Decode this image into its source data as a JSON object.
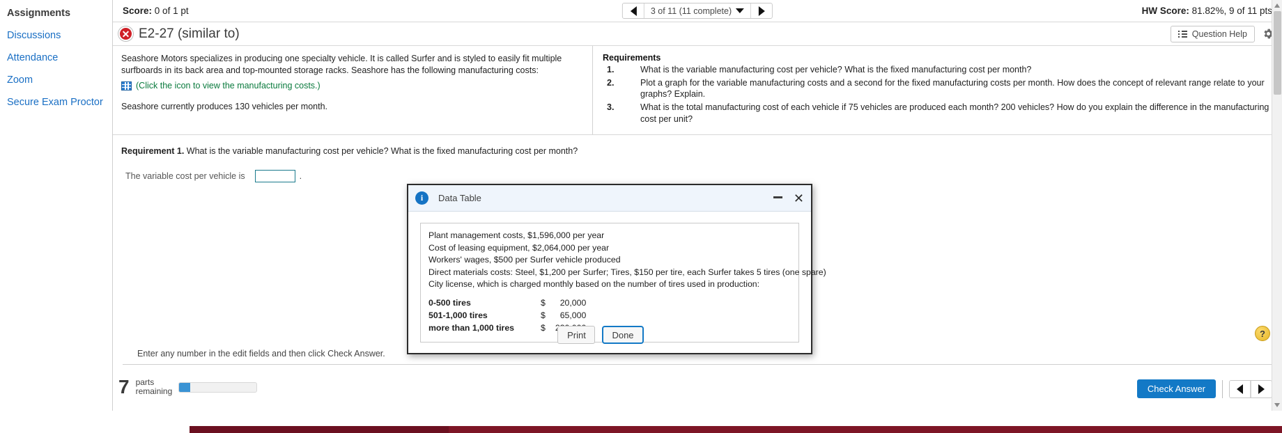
{
  "sidebar": {
    "items": [
      {
        "label": "Assignments",
        "active": true
      },
      {
        "label": "Discussions",
        "active": false
      },
      {
        "label": "Attendance",
        "active": false
      },
      {
        "label": "Zoom",
        "active": false
      },
      {
        "label": "Secure Exam Proctor",
        "active": false
      }
    ]
  },
  "topbar": {
    "score_label": "Score:",
    "score_value": "0 of 1 pt",
    "nav_selection": "3 of 11 (11 complete)",
    "prev_icon": "triangle-left-icon",
    "next_icon": "triangle-right-icon",
    "dropdown_icon": "caret-down-icon",
    "hw_score_label": "HW Score:",
    "hw_score_value": "81.82%, 9 of 11 pts"
  },
  "question_header": {
    "status_icon": "incorrect-x-icon",
    "status_glyph": "✕",
    "title": "E2-27 (similar to)",
    "help_button": "Question Help",
    "help_icon": "list-icon",
    "settings_icon": "gear-icon"
  },
  "problem": {
    "paragraph": "Seashore Motors specializes in producing one specialty vehicle. It is called Surfer and is styled to easily fit multiple surfboards in its back area and top-mounted storage racks. Seashore has the following manufacturing costs:",
    "data_link_icon": "table-grid-icon",
    "data_link": "(Click the icon to view the manufacturing costs.)",
    "production_line": "Seashore currently produces 130 vehicles per month."
  },
  "requirements": {
    "heading": "Requirements",
    "items": [
      {
        "num": "1.",
        "text": "What is the variable manufacturing cost per vehicle? What is the fixed manufacturing cost per month?"
      },
      {
        "num": "2.",
        "text": "Plot a graph for the variable manufacturing costs and a second for the fixed manufacturing costs per month. How does the concept of relevant range relate to your graphs? Explain."
      },
      {
        "num": "3.",
        "text": "What is the total manufacturing cost of each vehicle if 75 vehicles are produced each month? 200 vehicles? How do you explain the difference in the manufacturing cost per unit?"
      }
    ]
  },
  "requirement1": {
    "label": "Requirement 1.",
    "question": "What is the variable manufacturing cost per vehicle? What is the fixed manufacturing cost per month?",
    "answer_label": "The variable cost per vehicle is",
    "answer_value": "",
    "answer_placeholder": "",
    "period": "."
  },
  "footer": {
    "instruction": "Enter any number in the edit fields and then click Check Answer.",
    "parts_count": "7",
    "parts_label_line1": "parts",
    "parts_label_line2": "remaining",
    "progress_percent": 14,
    "check_answer": "Check Answer",
    "prev_icon": "triangle-left-icon",
    "next_icon": "triangle-right-icon",
    "help_icon": "question-mark-icon",
    "help_glyph": "?"
  },
  "modal": {
    "icon": "info-icon",
    "icon_glyph": "i",
    "title": "Data Table",
    "minimize_icon": "minimize-icon",
    "close_icon": "close-icon",
    "close_glyph": "✕",
    "lines": [
      "Plant management costs, $1,596,000 per year",
      "Cost of leasing equipment, $2,064,000 per year",
      "Workers' wages, $500 per Surfer vehicle produced",
      "Direct materials costs: Steel, $1,200 per Surfer; Tires, $150 per tire, each Surfer takes 5 tires (one spare)",
      "City license, which is charged monthly based on the number of tires used in production:"
    ],
    "rows": [
      {
        "label": "0-500 tires",
        "currency": "$",
        "value": "20,000"
      },
      {
        "label": "501-1,000 tires",
        "currency": "$",
        "value": "65,000"
      },
      {
        "label": "more than 1,000 tires",
        "currency": "$",
        "value": "230,000"
      }
    ],
    "print_button": "Print",
    "done_button": "Done"
  }
}
